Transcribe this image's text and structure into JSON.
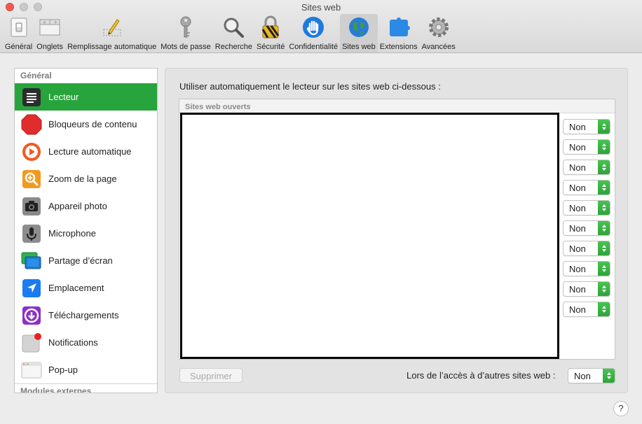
{
  "window": {
    "title": "Sites web"
  },
  "toolbar": {
    "items": [
      {
        "label": "Général",
        "icon": "general-switch-icon"
      },
      {
        "label": "Onglets",
        "icon": "tabs-icon"
      },
      {
        "label": "Remplissage automatique",
        "icon": "autofill-pencil-icon"
      },
      {
        "label": "Mots de passe",
        "icon": "key-icon"
      },
      {
        "label": "Recherche",
        "icon": "magnifier-icon"
      },
      {
        "label": "Sécurité",
        "icon": "lock-icon"
      },
      {
        "label": "Confidentialité",
        "icon": "hand-icon"
      },
      {
        "label": "Sites web",
        "icon": "globe-icon"
      },
      {
        "label": "Extensions",
        "icon": "puzzle-compass-icon"
      },
      {
        "label": "Avancées",
        "icon": "gear-icon"
      }
    ]
  },
  "sidebar": {
    "section": "Général",
    "items": [
      {
        "label": "Lecteur",
        "icon": "reader-icon"
      },
      {
        "label": "Bloqueurs de contenu",
        "icon": "stop-sign-icon"
      },
      {
        "label": "Lecture automatique",
        "icon": "play-icon"
      },
      {
        "label": "Zoom de la page",
        "icon": "zoom-icon"
      },
      {
        "label": "Appareil photo",
        "icon": "camera-icon"
      },
      {
        "label": "Microphone",
        "icon": "microphone-icon"
      },
      {
        "label": "Partage d’écran",
        "icon": "screen-share-icon"
      },
      {
        "label": "Emplacement",
        "icon": "location-arrow-icon"
      },
      {
        "label": "Téléchargements",
        "icon": "download-icon"
      },
      {
        "label": "Notifications",
        "icon": "notification-icon"
      },
      {
        "label": "Pop-up",
        "icon": "popup-window-icon"
      }
    ],
    "bottom_section": "Modules externes"
  },
  "main": {
    "heading": "Utiliser automatiquement le lecteur sur les sites web ci-dessous :",
    "table_header": "Sites web ouverts",
    "site_options": [
      "Non",
      "Non",
      "Non",
      "Non",
      "Non",
      "Non",
      "Non",
      "Non",
      "Non",
      "Non"
    ],
    "delete_label": "Supprimer",
    "other_sites_label": "Lors de l’accès à d’autres sites web :",
    "other_sites_value": "Non"
  },
  "help_label": "?",
  "colors": {
    "accent": "#27a43c",
    "close": "#ee5b53"
  }
}
